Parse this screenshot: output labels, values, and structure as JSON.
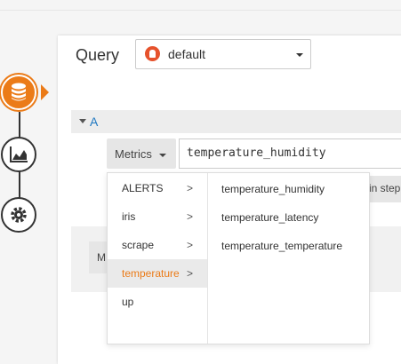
{
  "query_label": "Query",
  "datasource": {
    "name": "default",
    "icon": "prometheus-icon"
  },
  "query_row": {
    "ref_id": "A"
  },
  "metrics_button": "Metrics",
  "metric_input_value": "temperature_humidity",
  "step_chip_text": "in step",
  "m_chip_text": "M",
  "dropdown": {
    "chevron": ">",
    "categories": [
      {
        "label": "ALERTS",
        "has_children": true
      },
      {
        "label": "iris",
        "has_children": true
      },
      {
        "label": "scrape",
        "has_children": true
      },
      {
        "label": "temperature",
        "has_children": true,
        "selected": true
      },
      {
        "label": "up",
        "has_children": false
      }
    ],
    "submenu": [
      "temperature_humidity",
      "temperature_latency",
      "temperature_temperature"
    ]
  },
  "steps": [
    {
      "icon": "database-icon",
      "active": true
    },
    {
      "icon": "chart-icon",
      "active": false
    },
    {
      "icon": "gear-icon",
      "active": false
    }
  ],
  "colors": {
    "accent": "#eb7b18",
    "link": "#1f78c1",
    "prometheus": "#e6522c"
  }
}
